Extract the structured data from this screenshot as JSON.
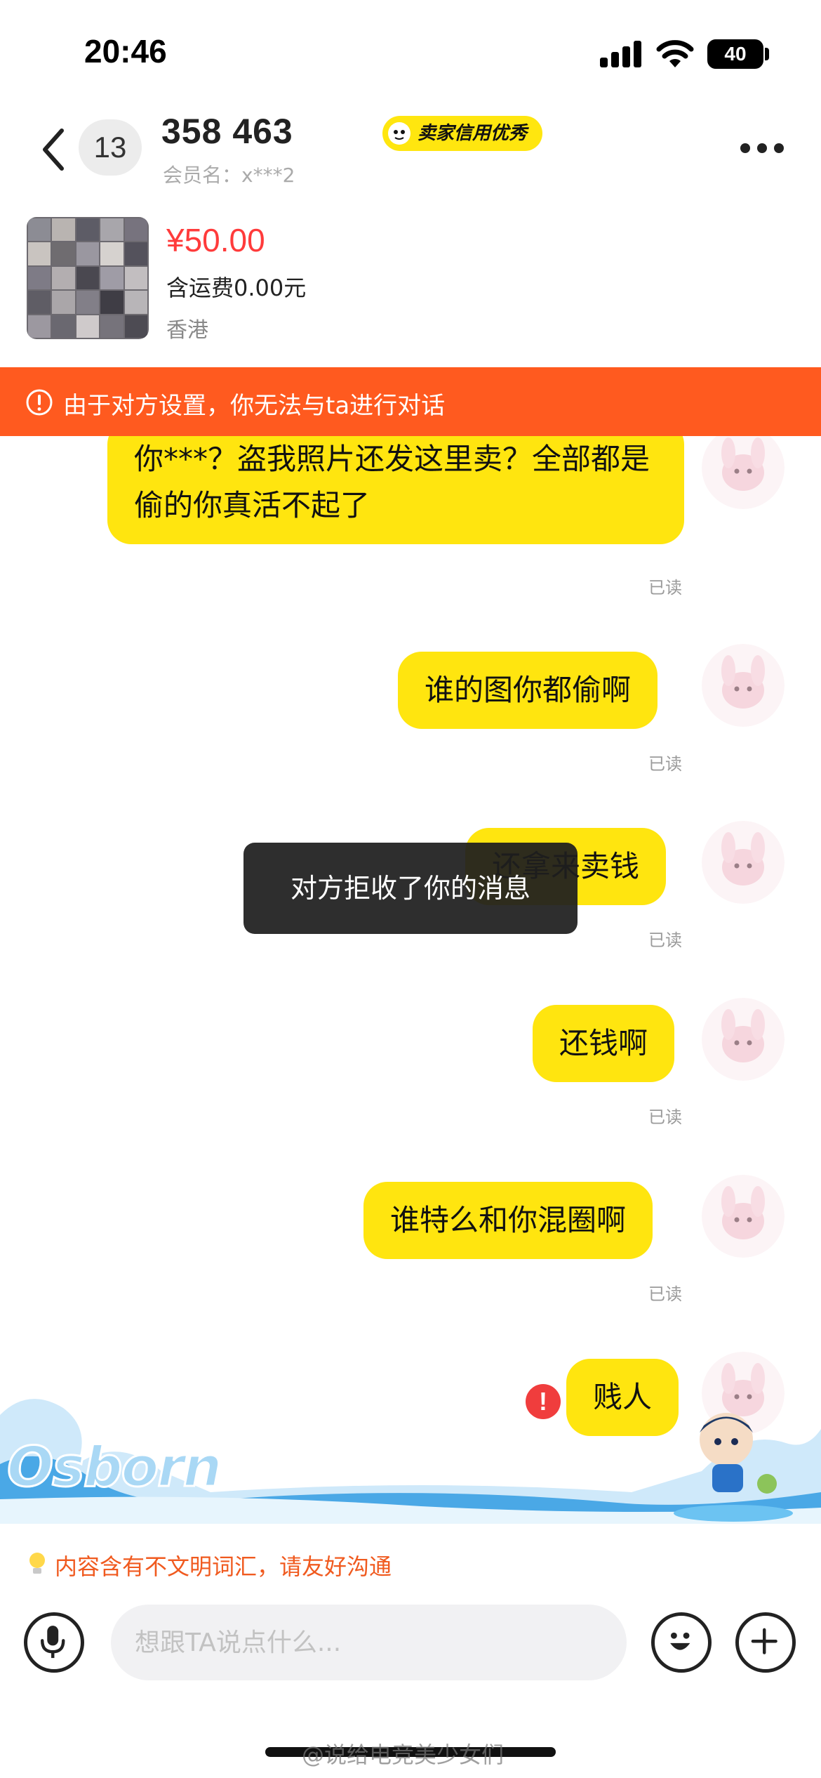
{
  "status_bar": {
    "time": "20:46",
    "battery": "40"
  },
  "header": {
    "unread_count": "13",
    "contact_name": "358  463",
    "credit_badge": "卖家信用优秀",
    "member_label": "会员名：x***2"
  },
  "product": {
    "price": "¥50.00",
    "shipping": "含运费0.00元",
    "location": "香港"
  },
  "banner": {
    "text": "由于对方设置，你无法与ta进行对话",
    "color": "#ff5a1f"
  },
  "messages": [
    {
      "text": "你***？盗我照片还发这里卖？全部都是偷的你真活不起了",
      "status": "已读"
    },
    {
      "text": "谁的图你都偷啊",
      "status": "已读"
    },
    {
      "text": "还拿来卖钱",
      "status": "已读"
    },
    {
      "text": "还钱啊",
      "status": "已读"
    },
    {
      "text": "谁特么和你混圈啊",
      "status": "已读"
    },
    {
      "text": "贱人",
      "status": "",
      "failed": true
    }
  ],
  "toast": "对方拒收了你的消息",
  "decoration": {
    "logo_text": "Osborn"
  },
  "civil_tip": "内容含有不文明词汇，请友好沟通",
  "input": {
    "placeholder": "想跟TA说点什么..."
  },
  "watermark": "@说给电竞美少女们",
  "colors": {
    "bubble": "#ffe50f",
    "accent": "#ff5a1f",
    "price": "#ff3b3b"
  }
}
